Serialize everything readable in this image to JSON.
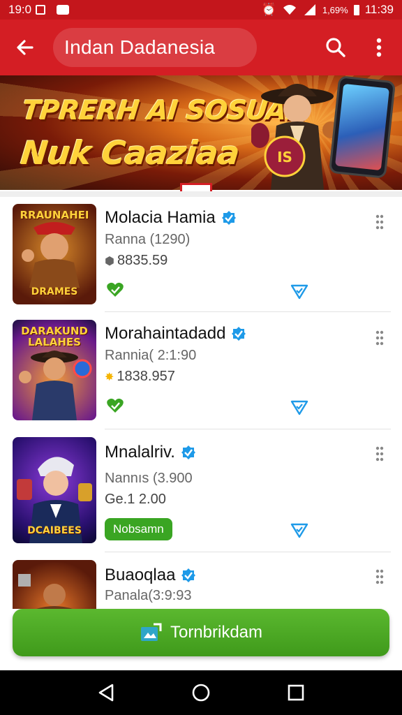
{
  "status_bar": {
    "time_left": "19:0",
    "battery": "1,69%",
    "time_right": "11:39"
  },
  "app_bar": {
    "title": "Indan Dadanesia"
  },
  "banner": {
    "line1": "TPRERH AI SOSUAN",
    "line2": "Nuk Caaziaa"
  },
  "items": [
    {
      "thumb_title": "RRAUNAHEI",
      "thumb_sub": "DRAMES",
      "title": "Molacia Hamia",
      "subtitle": "Ranna (1290)",
      "meta": "8835.59",
      "meta_icon": "tag-icon"
    },
    {
      "thumb_title": "DARAKUND LALAHES",
      "thumb_sub": "",
      "title": "Morahaintadadd",
      "subtitle": "Rannia( 2:1:90",
      "meta": "1838.957",
      "meta_icon": "coin-icon"
    },
    {
      "thumb_title": "",
      "thumb_sub": "DCAIBEES",
      "title": "Mnalalriv.",
      "subtitle": "Nannıs (3.900",
      "meta": "Ge.1 2.00",
      "meta_icon": "coin-icon",
      "chip": "Nobsamn"
    },
    {
      "thumb_title": "",
      "thumb_sub": "",
      "title": "Buaoqlaa",
      "subtitle": "Panala(3:9:93"
    }
  ],
  "cta": {
    "label": "Tornbrikdam"
  },
  "colors": {
    "primary": "#d41e24",
    "accent_green": "#3f9a1b",
    "verified_blue": "#1e9ae8"
  }
}
